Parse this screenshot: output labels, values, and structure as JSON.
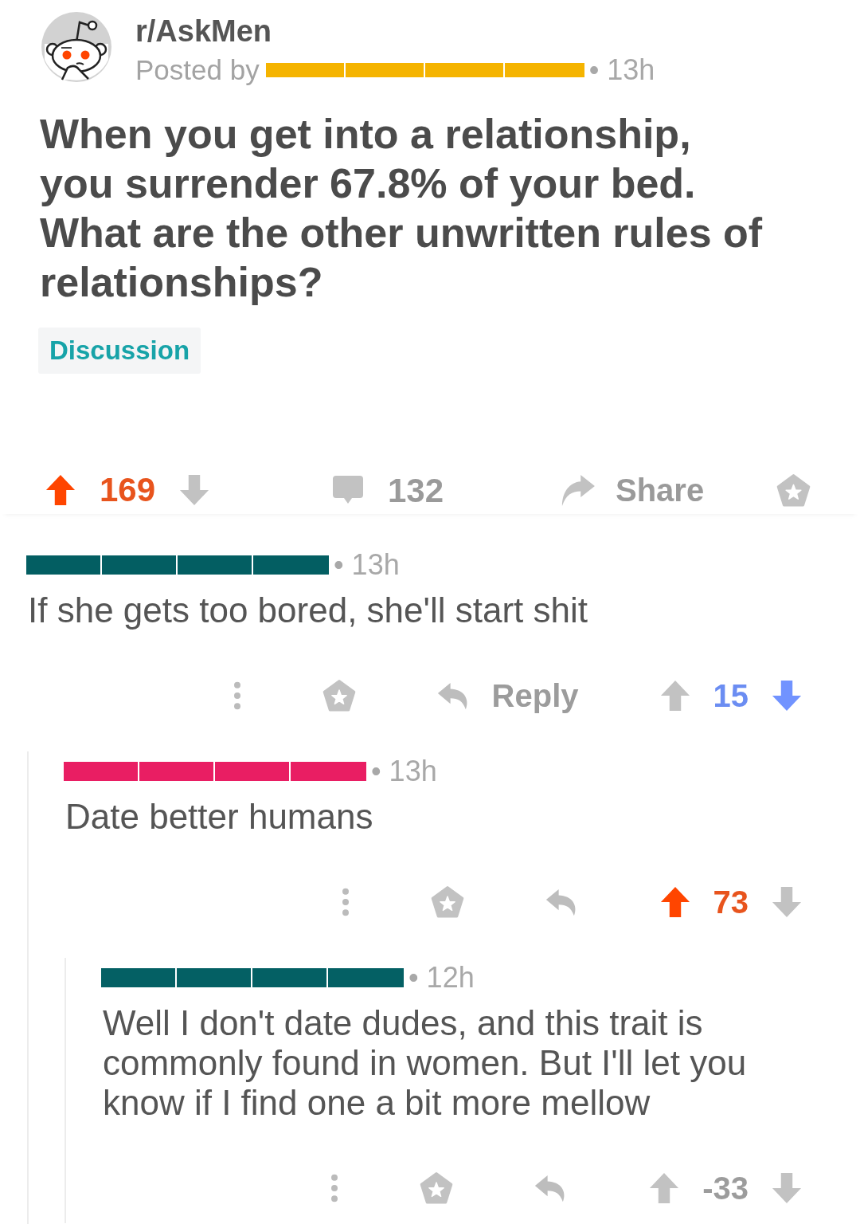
{
  "post": {
    "subreddit": "r/AskMen",
    "posted_by": "Posted by",
    "author_redaction": {
      "color": "#f5b400"
    },
    "time": "• 13h",
    "title": "When you get into a relationship, you surrender 67.8% of your bed. What are the other unwritten rules of relationships?",
    "flair": "Discussion",
    "upvoted": true,
    "downvoted": false,
    "score": "169",
    "comment_count": "132",
    "share_label": "Share"
  },
  "comments": [
    {
      "author_redaction": {
        "color": "#035e62"
      },
      "time": "• 13h",
      "body": "If she gets too bored, she'll start shit",
      "reply_label": "Reply",
      "upvoted": false,
      "downvoted": true,
      "score": "15",
      "children": [
        {
          "author_redaction": {
            "color": "#e91e63"
          },
          "time": "• 13h",
          "body": "Date better humans",
          "upvoted": true,
          "downvoted": false,
          "score": "73",
          "children": [
            {
              "author_redaction": {
                "color": "#046064"
              },
              "time": "• 12h",
              "body": "Well I don't date dudes, and this trait is commonly found in women. But I'll let you know if I find one a bit more mellow",
              "upvoted": false,
              "downvoted": false,
              "score": "-33"
            }
          ]
        }
      ]
    }
  ]
}
